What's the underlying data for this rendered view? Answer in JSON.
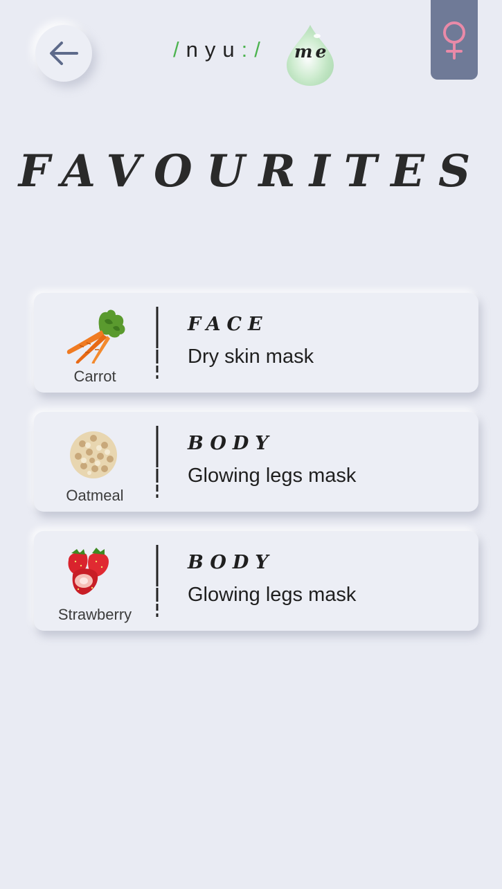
{
  "header": {
    "logo_prefix": "/",
    "logo_word": "nyu",
    "logo_sep": ":/",
    "logo_suffix": "me",
    "brand_green": "#4cb34f",
    "gender_symbol": "♀",
    "gender_color": "#e98aa8",
    "tab_color": "#6f7a97"
  },
  "page": {
    "title": "FAVOURITES"
  },
  "favourites": [
    {
      "ingredient": "Carrot",
      "category": "FACE",
      "name": "Dry skin mask",
      "icon": "carrot-icon"
    },
    {
      "ingredient": "Oatmeal",
      "category": "BODY",
      "name": "Glowing legs mask",
      "icon": "oatmeal-icon"
    },
    {
      "ingredient": "Strawberry",
      "category": "BODY",
      "name": "Glowing legs mask",
      "icon": "strawberry-icon"
    }
  ]
}
